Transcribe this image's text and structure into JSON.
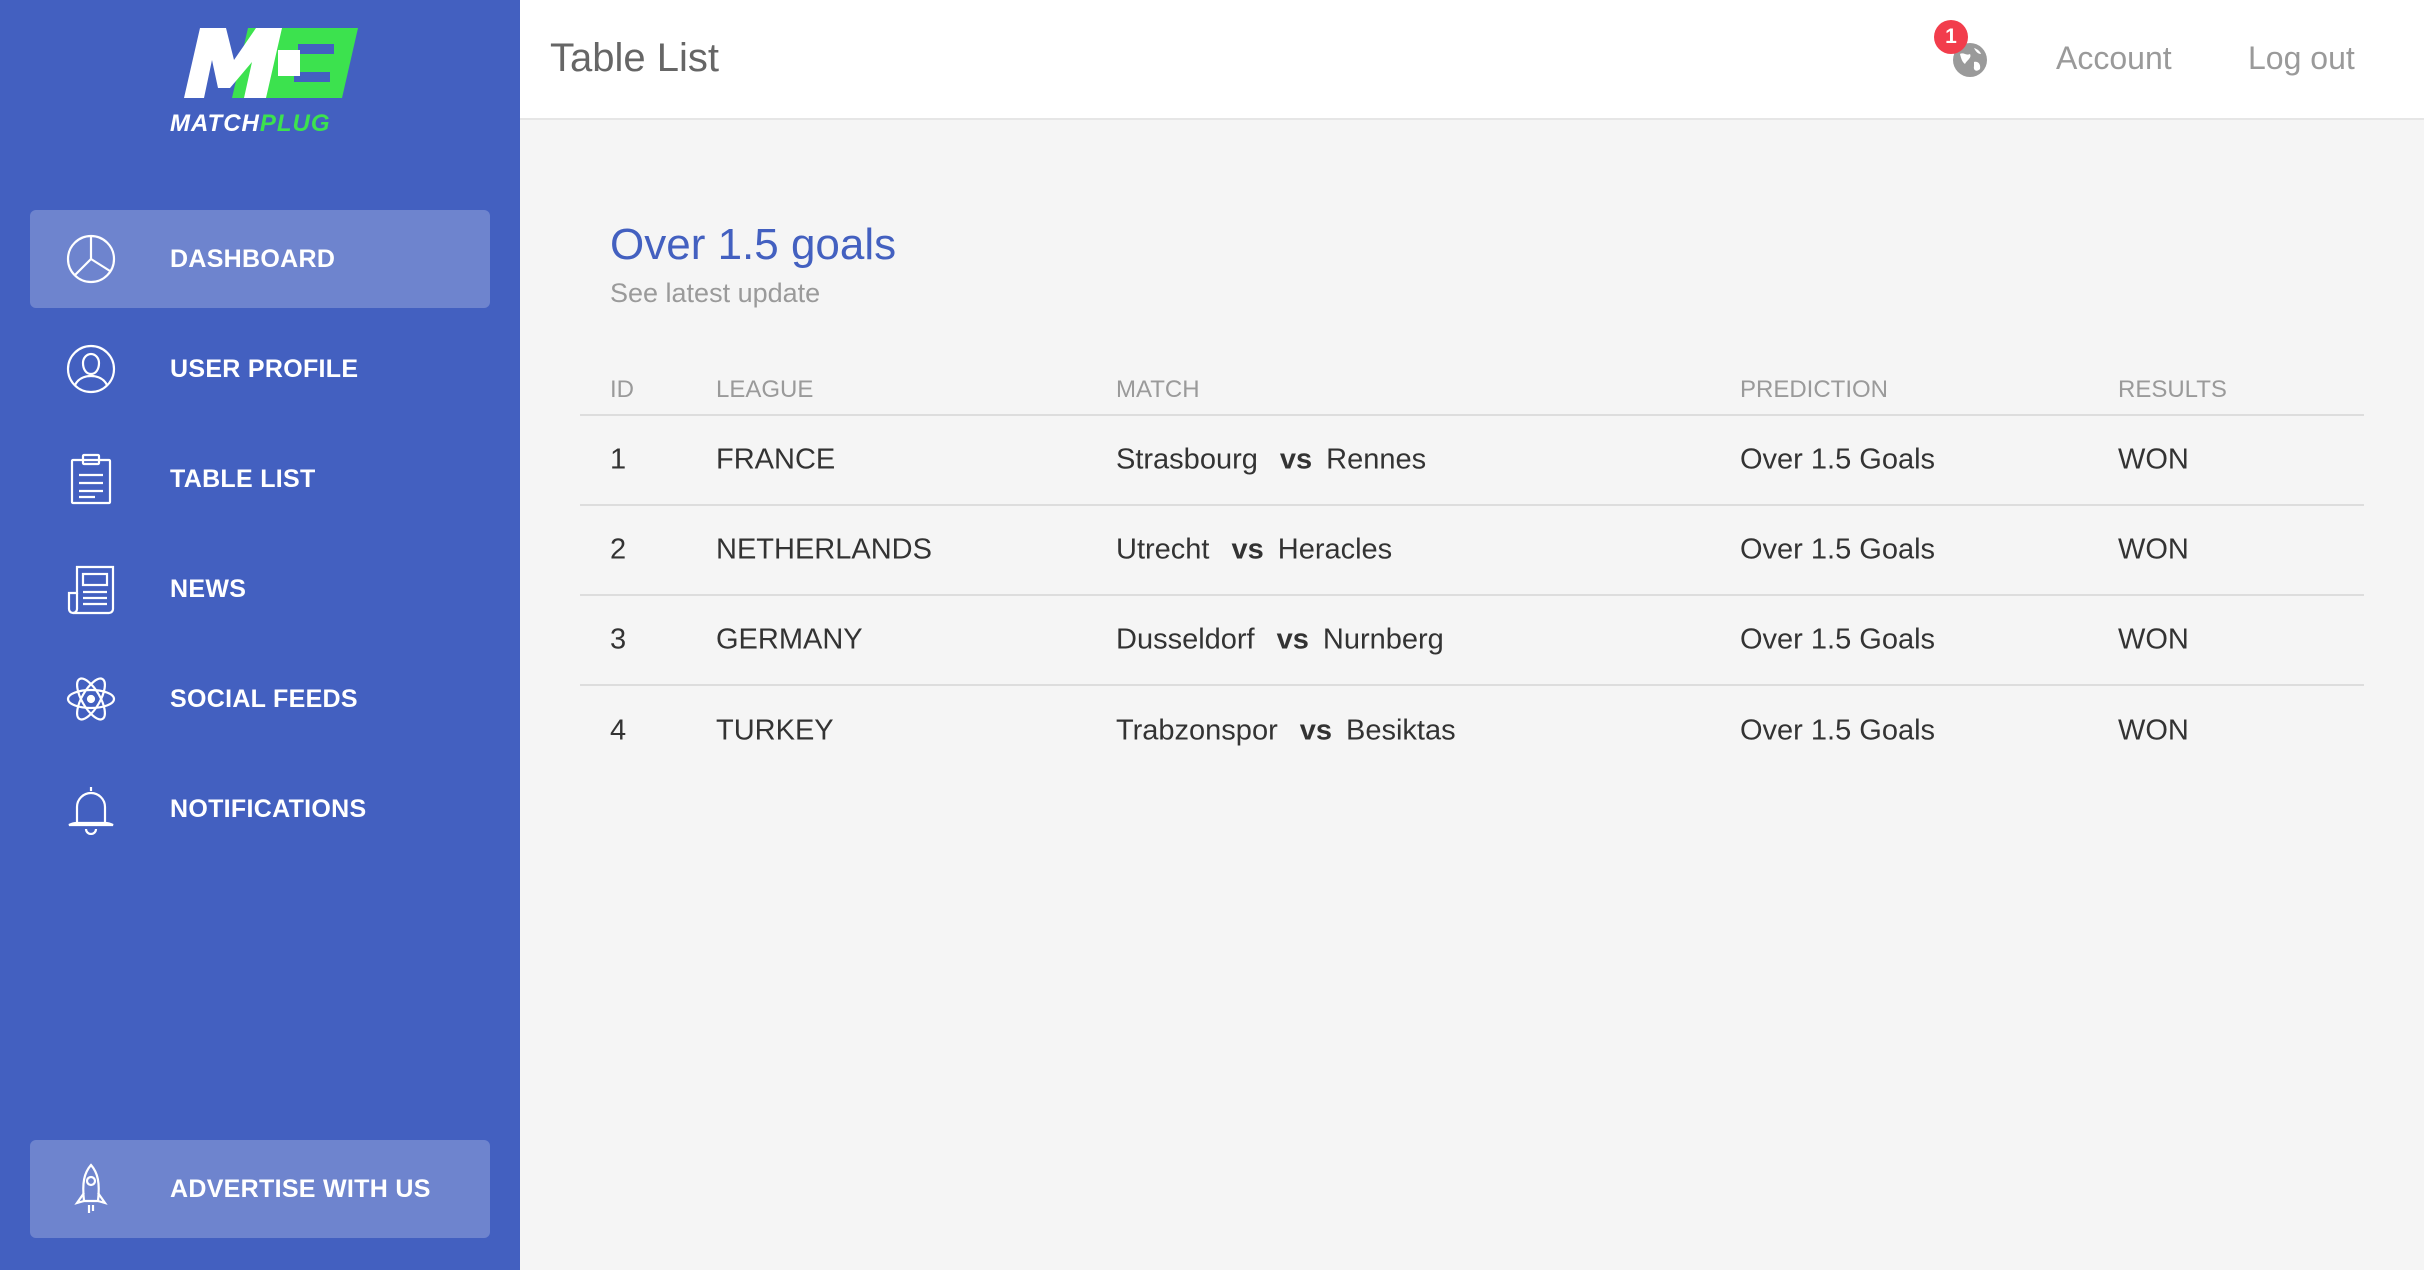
{
  "brand": {
    "mark": "M",
    "name_part1": "MATCH",
    "name_part2": "PLUG",
    "accent_green": "#3ce24e",
    "sidebar_blue": "#4360c0"
  },
  "sidebar": {
    "items": [
      {
        "label": "DASHBOARD",
        "icon": "pie-chart-icon",
        "active": true
      },
      {
        "label": "USER PROFILE",
        "icon": "user-icon",
        "active": false
      },
      {
        "label": "TABLE LIST",
        "icon": "clipboard-icon",
        "active": false
      },
      {
        "label": "NEWS",
        "icon": "newspaper-icon",
        "active": false
      },
      {
        "label": "SOCIAL FEEDS",
        "icon": "atom-icon",
        "active": false
      },
      {
        "label": "NOTIFICATIONS",
        "icon": "bell-icon",
        "active": false
      }
    ],
    "bottom": {
      "label": "ADVERTISE WITH US",
      "icon": "rocket-icon"
    }
  },
  "header": {
    "title": "Table List",
    "notification_count": "1",
    "account": "Account",
    "logout": "Log out"
  },
  "card": {
    "title": "Over 1.5 goals",
    "subtitle": "See latest update"
  },
  "table": {
    "columns": [
      "ID",
      "LEAGUE",
      "MATCH",
      "PREDICTION",
      "RESULTS"
    ],
    "vs": "vs",
    "rows": [
      {
        "id": "1",
        "league": "FRANCE",
        "home": "Strasbourg",
        "away": "Rennes",
        "prediction": "Over 1.5 Goals",
        "result": "WON"
      },
      {
        "id": "2",
        "league": "NETHERLANDS",
        "home": "Utrecht",
        "away": "Heracles",
        "prediction": "Over 1.5 Goals",
        "result": "WON"
      },
      {
        "id": "3",
        "league": "GERMANY",
        "home": "Dusseldorf",
        "away": "Nurnberg",
        "prediction": "Over 1.5 Goals",
        "result": "WON"
      },
      {
        "id": "4",
        "league": "TURKEY",
        "home": "Trabzonspor",
        "away": "Besiktas",
        "prediction": "Over 1.5 Goals",
        "result": "WON"
      }
    ]
  }
}
